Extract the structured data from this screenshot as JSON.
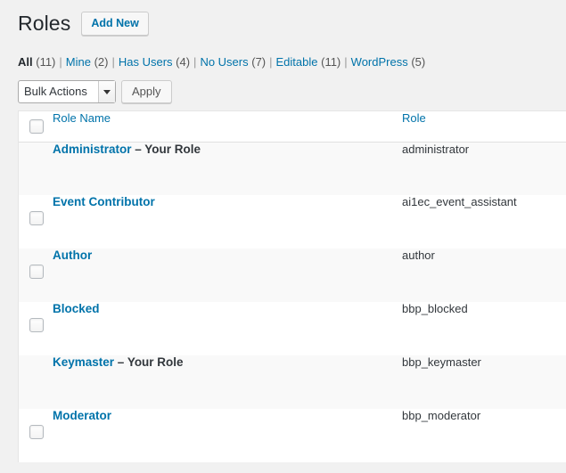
{
  "header": {
    "title": "Roles",
    "add_new_label": "Add New"
  },
  "filters": {
    "items": [
      {
        "label": "All",
        "count": "(11)",
        "current": true
      },
      {
        "label": "Mine",
        "count": "(2)",
        "current": false
      },
      {
        "label": "Has Users",
        "count": "(4)",
        "current": false
      },
      {
        "label": "No Users",
        "count": "(7)",
        "current": false
      },
      {
        "label": "Editable",
        "count": "(11)",
        "current": false
      },
      {
        "label": "WordPress",
        "count": "(5)",
        "current": false
      }
    ],
    "separator": "|"
  },
  "tablenav": {
    "bulk_actions_selected": "Bulk Actions",
    "apply_label": "Apply"
  },
  "table": {
    "columns": {
      "role_name": "Role Name",
      "role": "Role"
    },
    "your_role_suffix": "– Your Role",
    "rows": [
      {
        "name": "Administrator",
        "role": "administrator",
        "your_role": true,
        "checkbox": false
      },
      {
        "name": "Event Contributor",
        "role": "ai1ec_event_assistant",
        "your_role": false,
        "checkbox": true
      },
      {
        "name": "Author",
        "role": "author",
        "your_role": false,
        "checkbox": true
      },
      {
        "name": "Blocked",
        "role": "bbp_blocked",
        "your_role": false,
        "checkbox": true
      },
      {
        "name": "Keymaster",
        "role": "bbp_keymaster",
        "your_role": true,
        "checkbox": false
      },
      {
        "name": "Moderator",
        "role": "bbp_moderator",
        "your_role": false,
        "checkbox": true
      }
    ]
  },
  "colors": {
    "link": "#0073aa",
    "page_bg": "#f1f1f1",
    "row_alt_bg": "#f9f9f9",
    "heading": "#23282d"
  }
}
